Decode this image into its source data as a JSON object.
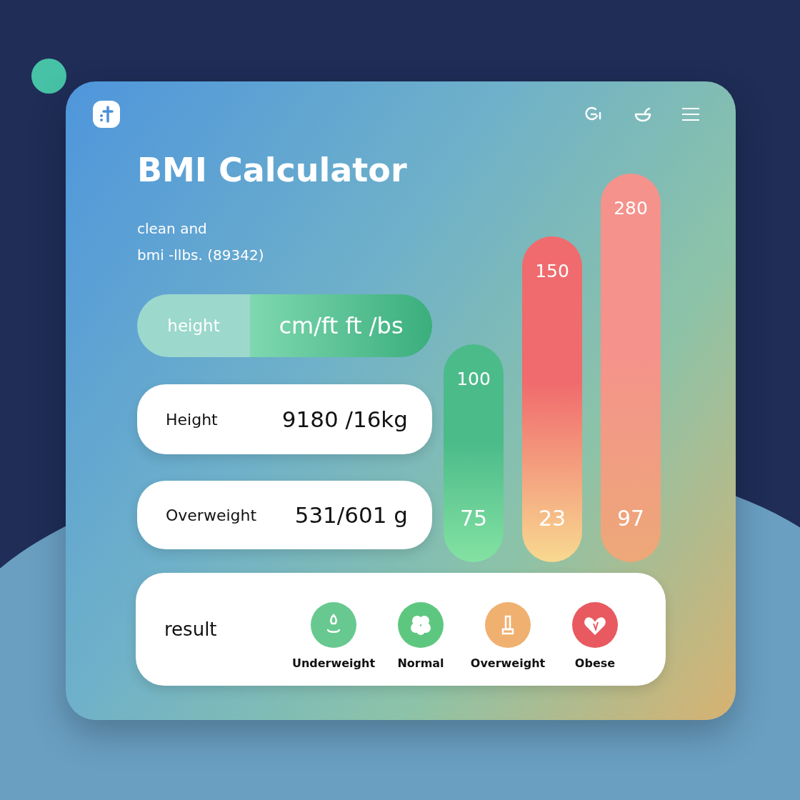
{
  "app": {
    "title": "BMI Calculator",
    "subtitle": [
      "clean and",
      "bmi -llbs. (89342)"
    ]
  },
  "unit_toggle": {
    "segments": [
      {
        "label": "height",
        "selected": false
      },
      {
        "label": "cm/ft ft /bs",
        "selected": true
      }
    ]
  },
  "fields": [
    {
      "label": "Height",
      "value": "9180 /16kg"
    },
    {
      "label": "Overweight",
      "value": "531/601 g"
    }
  ],
  "bars": [
    {
      "top_label": "100",
      "bottom_label": "75",
      "color": "#4cbb8a"
    },
    {
      "top_label": "150",
      "bottom_label": "23",
      "color": "#f06b6e"
    },
    {
      "top_label": "280",
      "bottom_label": "97",
      "color": "#f5928c"
    }
  ],
  "result": {
    "label": "result",
    "categories": [
      {
        "label": "Underweight",
        "color": "#67c98f",
        "kind": "drop"
      },
      {
        "label": "Normal",
        "color": "#5ec77f",
        "kind": "clover"
      },
      {
        "label": "Overweight",
        "color": "#f0b070",
        "kind": "figure"
      },
      {
        "label": "Obese",
        "color": "#e85a5f",
        "kind": "heart"
      }
    ]
  }
}
